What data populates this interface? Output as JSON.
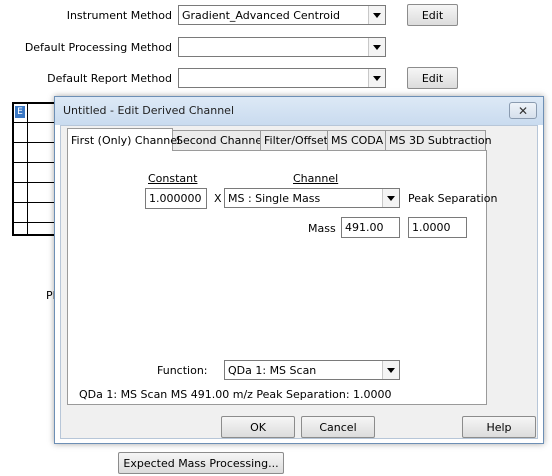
{
  "background": {
    "instrument_method_label": "Instrument Method",
    "instrument_method_value": "Gradient_Advanced Centroid",
    "default_processing_label": "Default Processing Method",
    "default_processing_value": "",
    "default_report_label": "Default Report Method",
    "default_report_value": "",
    "edit_label": "Edit",
    "grid_header_cell": "E",
    "partial_label": "Pl",
    "expected_mass_button": "Expected Mass Processing..."
  },
  "dialog": {
    "title": "Untitled - Edit Derived Channel",
    "close_glyph": "✕",
    "tabs": [
      {
        "label": "First (Only) Channel",
        "active": true
      },
      {
        "label": "Second Channel",
        "active": false
      },
      {
        "label": "Filter/Offset",
        "active": false
      },
      {
        "label": "MS CODA",
        "active": false
      },
      {
        "label": "MS 3D Subtraction",
        "active": false
      }
    ],
    "constant_label": "Constant",
    "constant_value": "1.000000",
    "multiply_sign": "X",
    "channel_label": "Channel",
    "channel_value": "MS : Single Mass",
    "peak_separation_label": "Peak Separation",
    "peak_separation_value": "1.0000",
    "mass_label": "Mass",
    "mass_value": "491.00",
    "function_label": "Function:",
    "function_value": "QDa 1: MS Scan",
    "summary_text": "QDa 1: MS Scan MS 491.00 m/z Peak Separation: 1.0000",
    "ok_label": "OK",
    "cancel_label": "Cancel",
    "help_label": "Help"
  }
}
